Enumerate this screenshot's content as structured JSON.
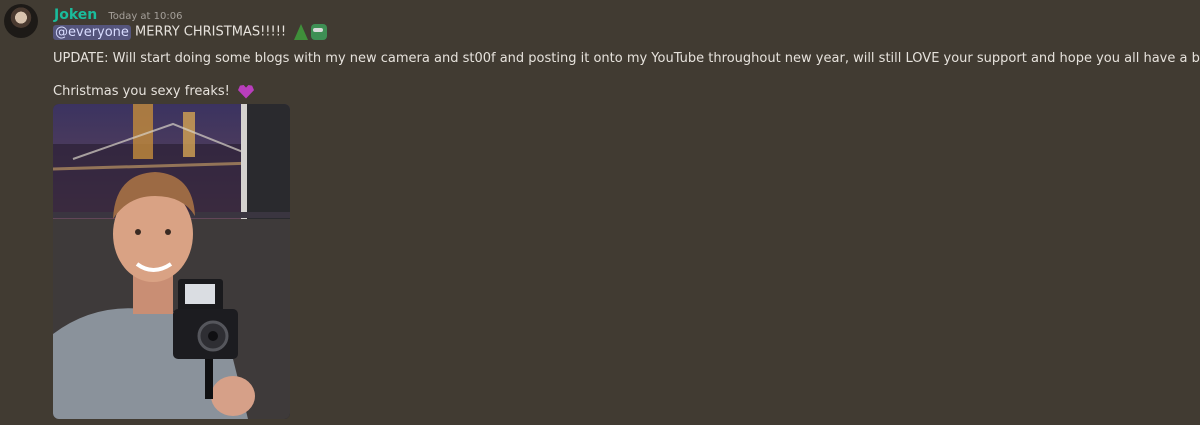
{
  "message": {
    "author": "Joken",
    "timestamp": "Today at 10:06",
    "mention": "@everyone",
    "line1_text": " MERRY CHRISTMAS!!!!! ",
    "line2_text": "UPDATE: Will start doing some blogs with my new camera and st00f and posting it onto my YouTube throughout new year, will still LOVE your support and hope you all have a blessed",
    "line3_text": "Christmas you sexy freaks! ",
    "emojis": [
      "christmas-tree-icon",
      "pepe-emoji-icon",
      "purple-heart-icon"
    ]
  },
  "colors": {
    "background": "#413b32",
    "author": "#1abc9c",
    "mention_bg": "#55557d"
  }
}
